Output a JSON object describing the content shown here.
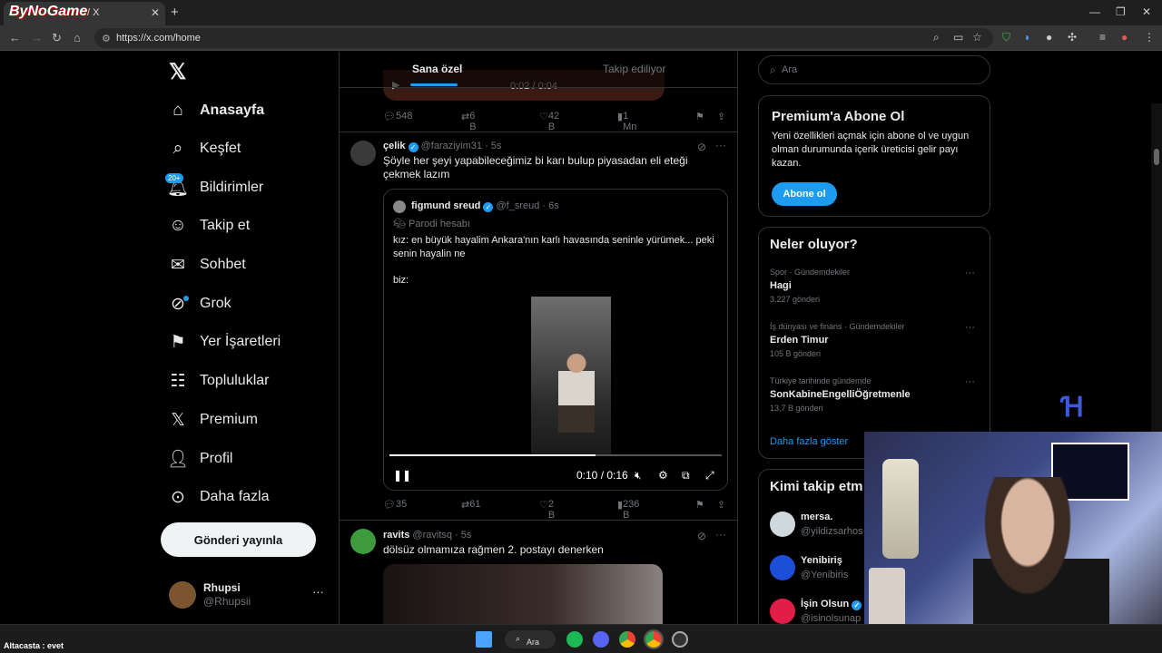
{
  "browser": {
    "tab_title": "/ X",
    "brand_overlay": "ByNoGame",
    "url": "https://x.com/home"
  },
  "nav": {
    "items": [
      {
        "label": "Anasayfa",
        "icon": "home-icon"
      },
      {
        "label": "Keşfet",
        "icon": "search-icon"
      },
      {
        "label": "Bildirimler",
        "icon": "bell-icon",
        "badge": "20+"
      },
      {
        "label": "Takip et",
        "icon": "follow-icon"
      },
      {
        "label": "Sohbet",
        "icon": "mail-icon"
      },
      {
        "label": "Grok",
        "icon": "grok-icon"
      },
      {
        "label": "Yer İşaretleri",
        "icon": "bookmark-icon"
      },
      {
        "label": "Topluluklar",
        "icon": "communities-icon"
      },
      {
        "label": "Premium",
        "icon": "x-icon"
      },
      {
        "label": "Profil",
        "icon": "profile-icon"
      },
      {
        "label": "Daha fazla",
        "icon": "more-icon"
      }
    ],
    "post_button": "Gönderi yayınla",
    "profile": {
      "name": "Rhupsi",
      "handle": "@Rhupsii"
    }
  },
  "timeline": {
    "tabs": [
      "Sana özel",
      "Takip ediliyor"
    ],
    "prev_post": {
      "media_time": "0:02 / 0:04",
      "replies": "548",
      "reposts": "6 B",
      "likes": "42 B",
      "views": "1 Mn"
    },
    "post1": {
      "name": "çelik",
      "handle": "@faraziyim31",
      "time": "5s",
      "text": "Şöyle her şeyi yapabileceğimiz bi karı bulup piyasadan eli eteği çekmek lazım",
      "quote": {
        "name": "figmund sreud",
        "handle": "@f_sreud",
        "time": "6s",
        "label": "Parodi hesabı",
        "text": "kız: en büyük hayalim Ankara'nın karlı havasında seninle yürümek... peki senin hayalin ne",
        "text2": "biz:",
        "video_time": "0:10 / 0:16",
        "progress": 0.62
      },
      "replies": "35",
      "reposts": "61",
      "likes": "2 B",
      "views": "236 B"
    },
    "post2": {
      "name": "ravits",
      "handle": "@ravitsq",
      "time": "5s",
      "text": "dölsüz olmamıza rağmen 2. postayı denerken"
    }
  },
  "sidebar": {
    "search_placeholder": "Ara",
    "premium": {
      "title": "Premium'a Abone Ol",
      "text": "Yeni özellikleri açmak için abone ol ve uygun olman durumunda içerik üreticisi gelir payı kazan.",
      "button": "Abone ol"
    },
    "trends_title": "Neler oluyor?",
    "trends": [
      {
        "category": "Spor · Gündemdekiler",
        "title": "Hagi",
        "count": "3.227 gönderi"
      },
      {
        "category": "İş dünyası ve finans · Gündemdekiler",
        "title": "Erden Timur",
        "count": "105 B gönderi"
      },
      {
        "category": "Türkiye tarihinde gündemde",
        "title": "SonKabineEngelliÖğretmenle",
        "count": "13,7 B gönderi"
      }
    ],
    "show_more": "Daha fazla göster",
    "follow_title": "Kimi takip etm",
    "follow": [
      {
        "name": "mersa.",
        "handle": "@yildizsarhos",
        "color": "#cfd8dc"
      },
      {
        "name": "Yenibiriş",
        "handle": "@Yenibiris",
        "color": "#1d4ed8"
      },
      {
        "name": "İşin Olsun",
        "handle": "@isinolsunap",
        "color": "#e11d48"
      }
    ]
  },
  "taskbar": {
    "overlay_text": "Altacasta : evet",
    "search": "Ara"
  }
}
